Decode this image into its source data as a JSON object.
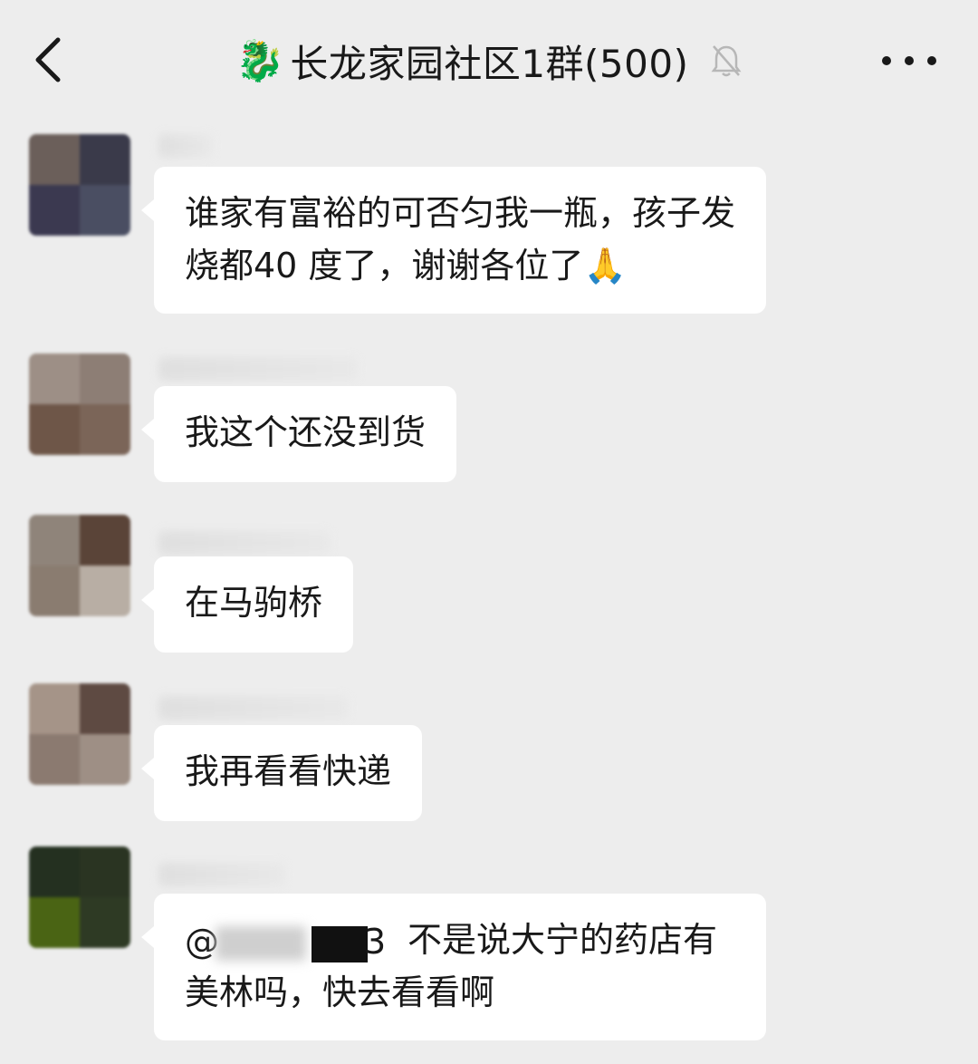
{
  "header": {
    "title_emoji": "🐉",
    "title": "长龙家园社区1群(500)",
    "back_icon": "chevron-left-icon",
    "mute_icon": "bell-off-icon",
    "more_icon": "more-horizontal-icon"
  },
  "messages": [
    {
      "text": "谁家有富裕的可否匀我一瓶，孩子发烧都40 度了，谢谢各位了",
      "emoji": "🙏"
    },
    {
      "text": "我这个还没到货"
    },
    {
      "text": "在马驹桥"
    },
    {
      "text": "我再看看快递"
    },
    {
      "mention_at": "@",
      "mention_tail": "3",
      "text": "不是说大宁的药店有美林吗，快去看看啊"
    }
  ],
  "colors": {
    "background": "#ededed",
    "bubble": "#ffffff",
    "text": "#191919"
  }
}
